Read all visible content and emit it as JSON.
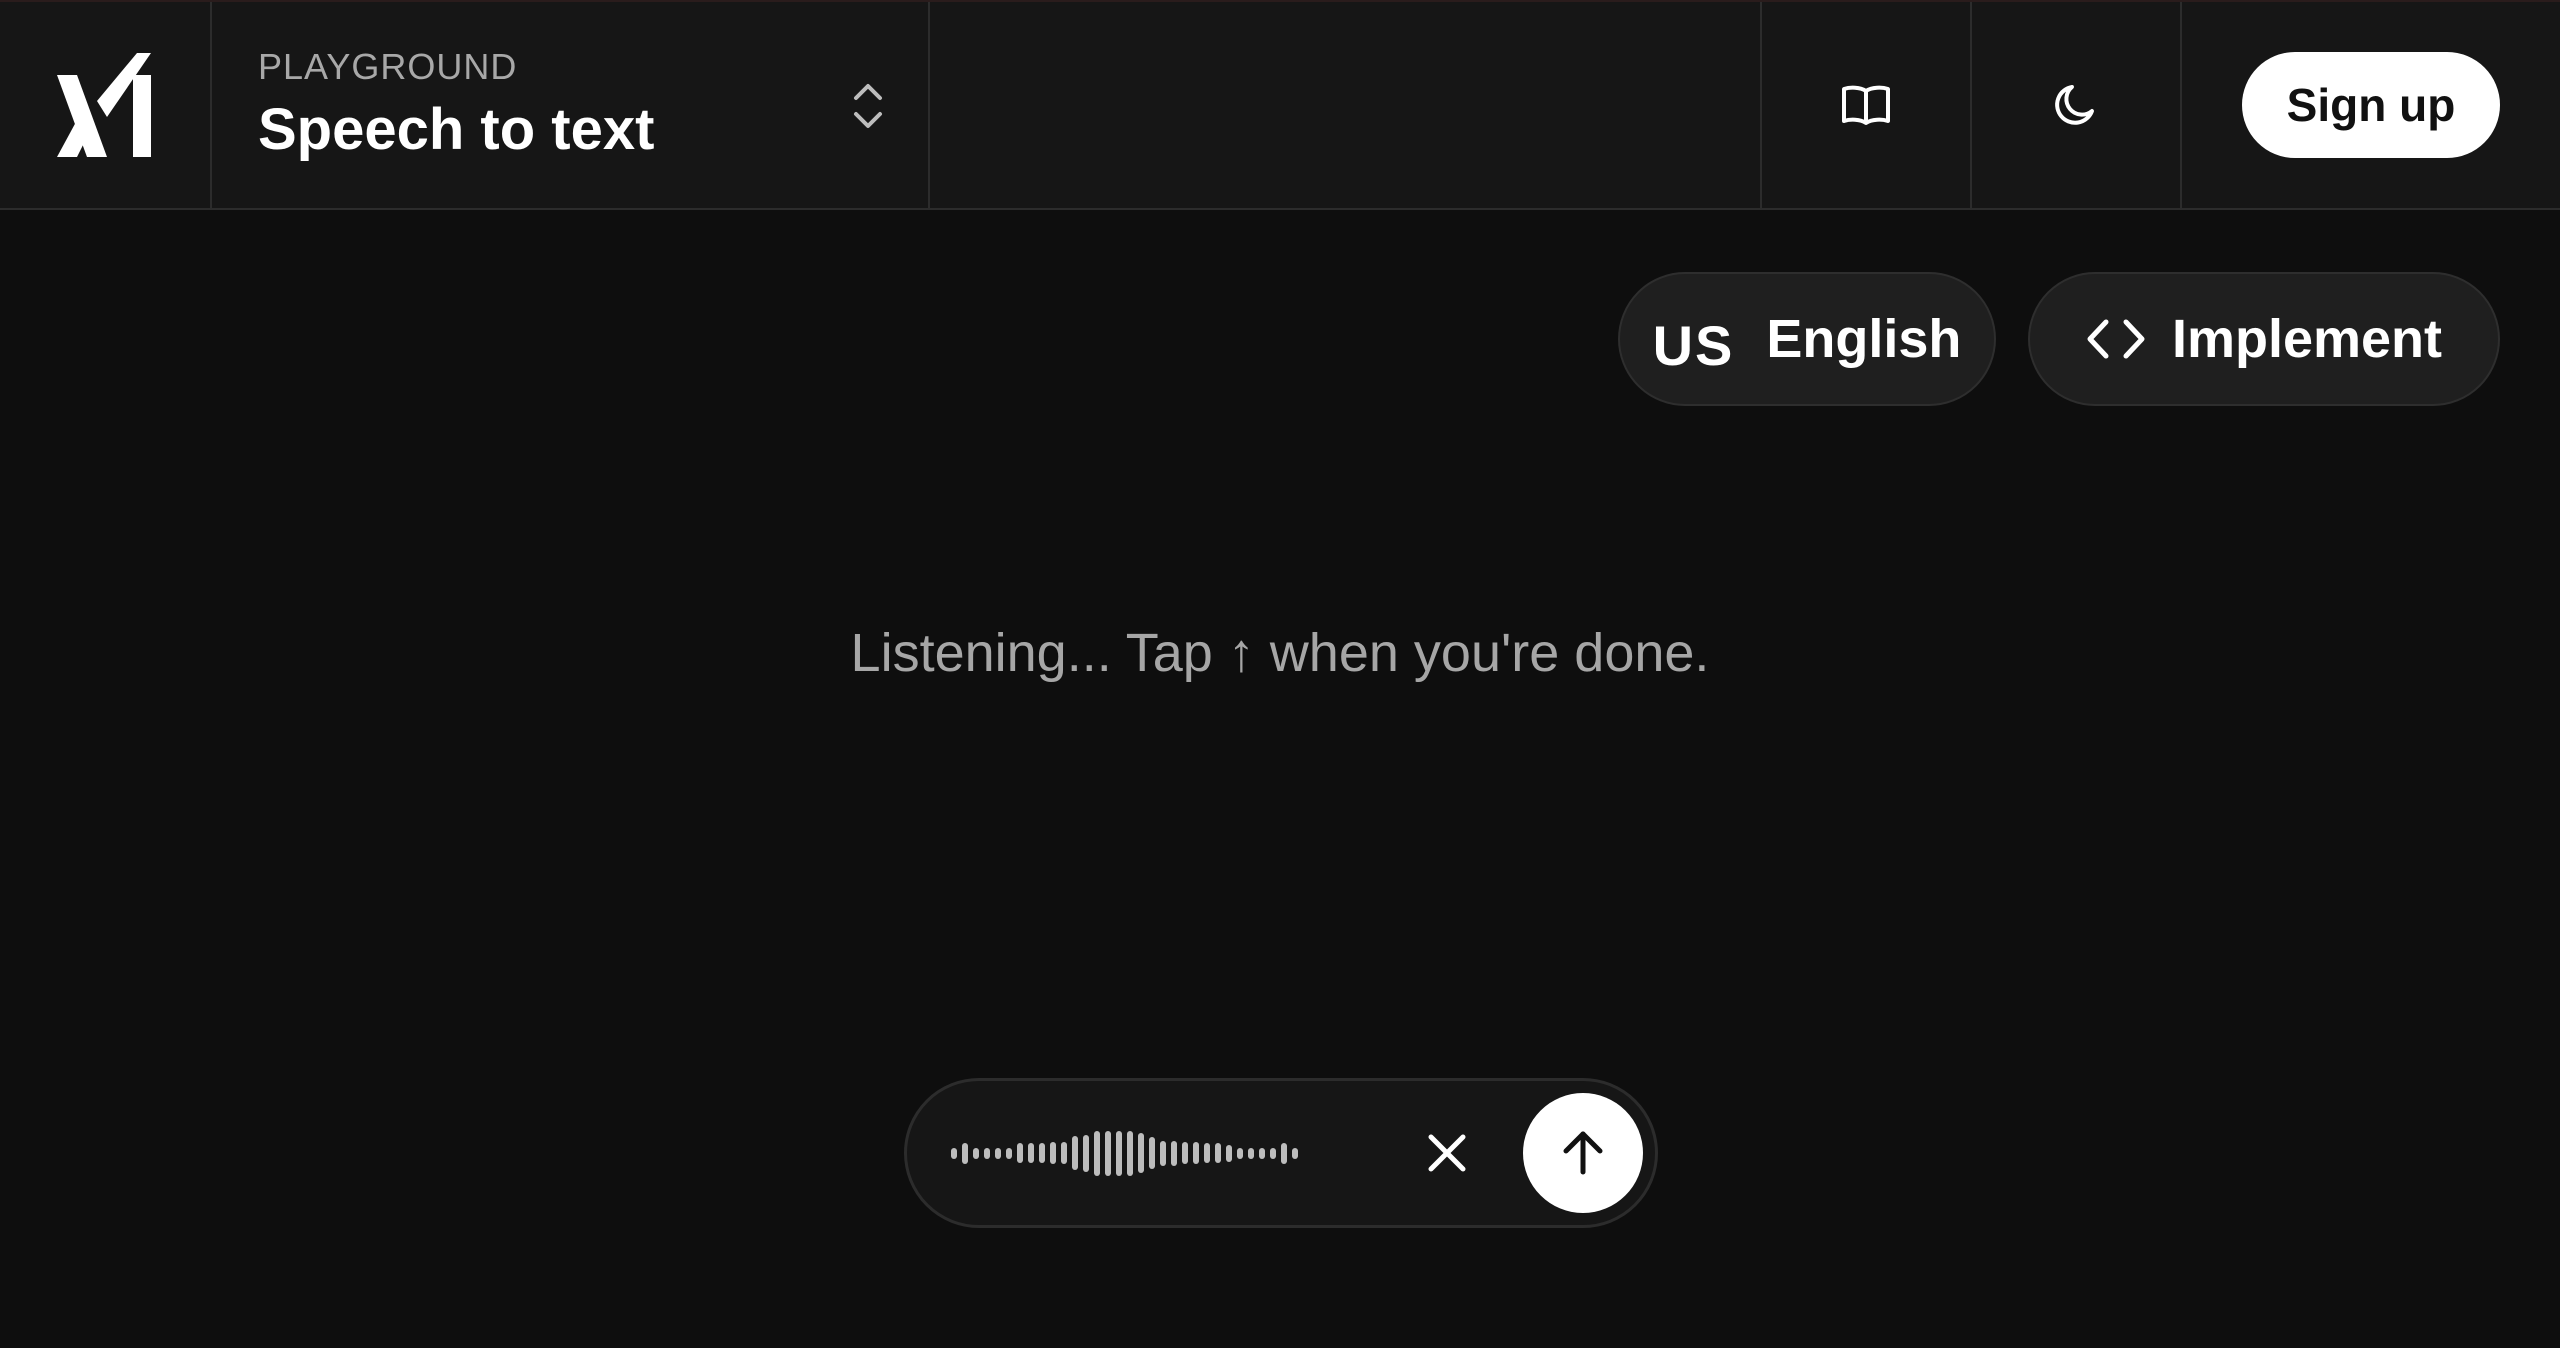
{
  "header": {
    "logo_icon": "xai-logo-icon",
    "mode_label": "PLAYGROUND",
    "mode_title": "Speech to text",
    "mode_selector_icon": "chevron-up-down-icon",
    "docs_icon": "book-icon",
    "theme_icon": "moon-icon",
    "signup_label": "Sign up"
  },
  "toolbar": {
    "language_code": "US",
    "language_label": "English",
    "implement_icon": "code-icon",
    "implement_label": "Implement"
  },
  "main": {
    "status_text": "Listening... Tap ↑ when you're done."
  },
  "recorder": {
    "waveform_icon": "waveform-icon",
    "cancel_icon": "close-icon",
    "submit_icon": "arrow-up-icon",
    "waveform_levels": [
      0.2,
      0.38,
      0.2,
      0.2,
      0.2,
      0.2,
      0.35,
      0.35,
      0.35,
      0.4,
      0.4,
      0.6,
      0.66,
      0.8,
      0.8,
      0.8,
      0.8,
      0.72,
      0.58,
      0.45,
      0.45,
      0.4,
      0.4,
      0.35,
      0.35,
      0.3,
      0.2,
      0.2,
      0.2,
      0.2,
      0.38,
      0.2
    ]
  },
  "colors": {
    "background": "#0e0e0e",
    "header_background": "#161616",
    "pill_background": "#1f1f1f",
    "muted_text": "#a6a6a6",
    "primary_button": "#ffffff"
  }
}
